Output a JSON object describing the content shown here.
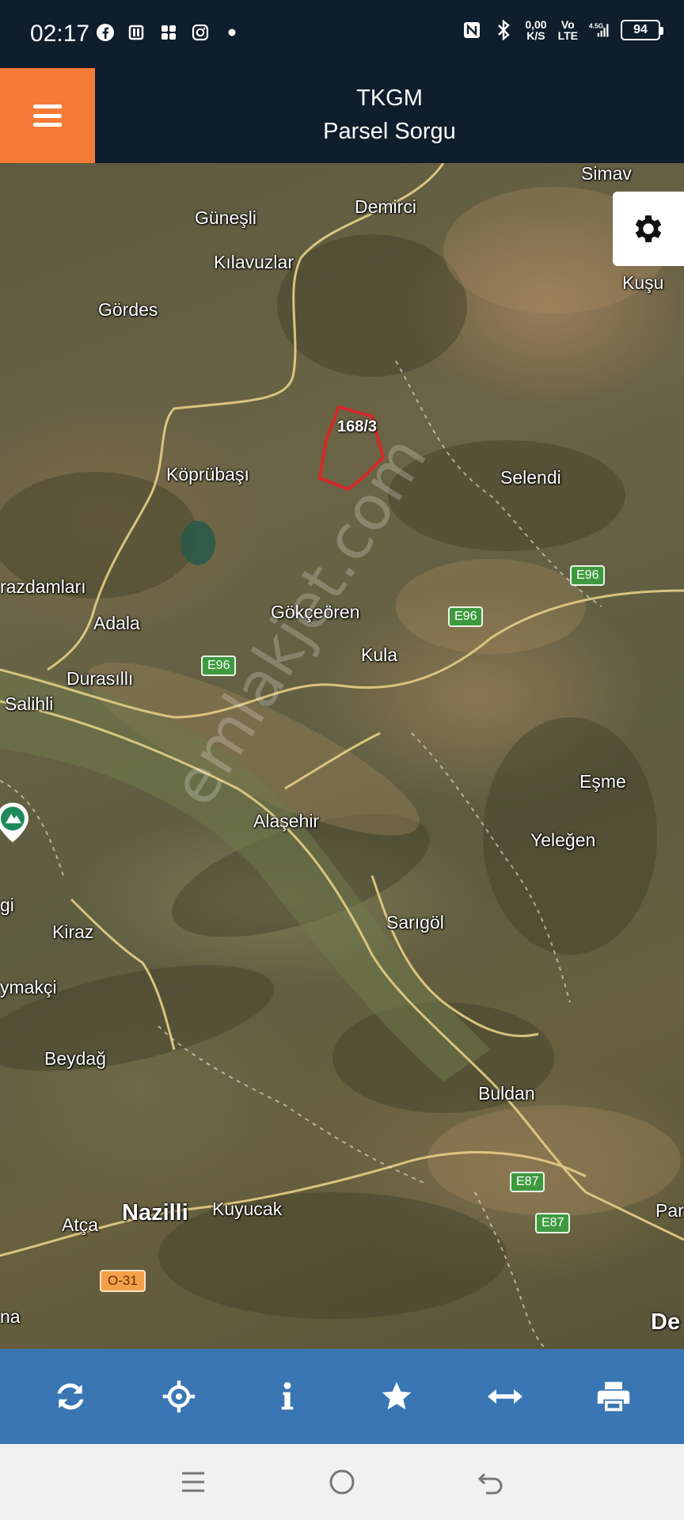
{
  "status_bar": {
    "time": "02:17",
    "left_icons": [
      "facebook-icon",
      "news-icon",
      "apps-icon",
      "instagram-icon",
      "dot-icon"
    ],
    "net_speed_value": "0,00",
    "net_speed_unit": "K/S",
    "net_type_top": "Vo",
    "net_type_bottom": "LTE",
    "signal_label": "4.5G",
    "battery": "94"
  },
  "header": {
    "title": "TKGM",
    "subtitle": "Parsel Sorgu",
    "menu_icon": "hamburger-icon",
    "brand_color": "#f47b36",
    "header_color": "#0f1d2c"
  },
  "map": {
    "parcel_label": "168/3",
    "parcel_color": "#d42a2a",
    "watermark": "emlakjet.com",
    "places": [
      {
        "name": "Simav",
        "id": "simav"
      },
      {
        "name": "Demirci",
        "id": "demirci"
      },
      {
        "name": "Güneşli",
        "id": "guneşli"
      },
      {
        "name": "Kılavuzlar",
        "id": "kilavuzlar"
      },
      {
        "name": "Gördes",
        "id": "gordes"
      },
      {
        "name": "Kuşu",
        "id": "kusu"
      },
      {
        "name": "Köprübaşı",
        "id": "koprubasi"
      },
      {
        "name": "Selendi",
        "id": "selendi"
      },
      {
        "name": "razdamları",
        "id": "karazdamlari"
      },
      {
        "name": "Adala",
        "id": "adala"
      },
      {
        "name": "Gökçeören",
        "id": "gokceoren"
      },
      {
        "name": "Kula",
        "id": "kula"
      },
      {
        "name": "Durasıllı",
        "id": "durasilli"
      },
      {
        "name": "Salihli",
        "id": "salihli"
      },
      {
        "name": "Eşme",
        "id": "esme"
      },
      {
        "name": "Alaşehir",
        "id": "alasehir"
      },
      {
        "name": "Yeleğen",
        "id": "yelegen"
      },
      {
        "name": "gi",
        "id": "gi"
      },
      {
        "name": "Sarıgöl",
        "id": "sarigol"
      },
      {
        "name": "Kiraz",
        "id": "kiraz"
      },
      {
        "name": "ymakçi",
        "id": "ymakci"
      },
      {
        "name": "Beydağ",
        "id": "beydag"
      },
      {
        "name": "Buldan",
        "id": "buldan"
      },
      {
        "name": "Nazilli",
        "id": "nazilli"
      },
      {
        "name": "Kuyucak",
        "id": "kuyucak"
      },
      {
        "name": "Atça",
        "id": "atca"
      },
      {
        "name": "Par",
        "id": "par"
      },
      {
        "name": "na",
        "id": "na"
      },
      {
        "name": "De",
        "id": "de"
      }
    ],
    "roads": [
      {
        "label": "E96",
        "id": "e96-a"
      },
      {
        "label": "E96",
        "id": "e96-b"
      },
      {
        "label": "E96",
        "id": "e96-c"
      },
      {
        "label": "E87",
        "id": "e87-a"
      },
      {
        "label": "E87",
        "id": "e87-b"
      },
      {
        "label": "O-31",
        "id": "o31"
      }
    ],
    "settings_icon": "gear-icon"
  },
  "toolbar": {
    "color": "#3a76b4",
    "buttons": [
      {
        "icon": "refresh-icon"
      },
      {
        "icon": "locate-icon"
      },
      {
        "icon": "info-icon"
      },
      {
        "icon": "star-icon"
      },
      {
        "icon": "measure-arrows-icon"
      },
      {
        "icon": "print-icon"
      }
    ]
  },
  "nav_bar": {
    "buttons": [
      {
        "icon": "recents-icon"
      },
      {
        "icon": "home-icon"
      },
      {
        "icon": "back-icon"
      }
    ]
  }
}
